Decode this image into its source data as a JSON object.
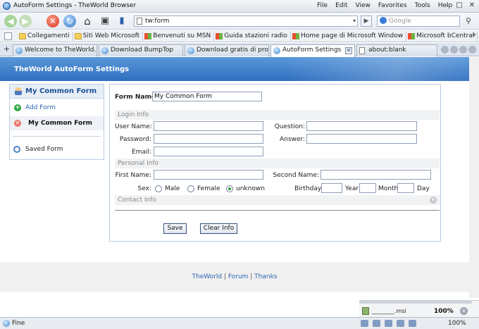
{
  "window": {
    "title": "AutoForm Settings - TheWorld Browser",
    "menu": [
      "File",
      "Edit",
      "View",
      "Favorites",
      "Tools",
      "Help"
    ]
  },
  "nav": {
    "address": "tw:form",
    "search_placeholder": "Google"
  },
  "favorites": [
    {
      "label": "Collegamenti",
      "icon": "folder-icon"
    },
    {
      "label": "Siti Web Microsoft",
      "icon": "folder-icon"
    },
    {
      "label": "Benvenuti su MSN",
      "icon": "windows-icon"
    },
    {
      "label": "Guida stazioni radio",
      "icon": "windows-icon"
    },
    {
      "label": "Home page di Microsoft Window",
      "icon": "windows-icon"
    },
    {
      "label": "Microsoft bCentral",
      "icon": "windows-icon"
    }
  ],
  "tabs": [
    {
      "label": "Welcome to TheWorld..."
    },
    {
      "label": "Download BumpTop"
    },
    {
      "label": "Download gratis di pro..."
    },
    {
      "label": "AutoForm Settings",
      "active": true
    },
    {
      "label": "about:blank"
    }
  ],
  "page": {
    "banner_title": "TheWorld AutoForm Settings",
    "sidebar": {
      "header": "My Common Form",
      "add_form": "Add Form",
      "current_form": "My Common Form",
      "saved_form": "Saved Form"
    },
    "form": {
      "form_name_label": "Form Name:",
      "form_name_value": "My Common Form",
      "login_section": "Login Info",
      "user_name_label": "User Name:",
      "password_label": "Password:",
      "email_label": "Email:",
      "question_label": "Question:",
      "answer_label": "Answer:",
      "personal_section": "Personal Info",
      "first_name_label": "First Name:",
      "second_name_label": "Second Name:",
      "sex_label": "Sex:",
      "sex_options": [
        "Male",
        "Female",
        "unknown"
      ],
      "sex_selected": "unknown",
      "birthday_label": "Birthday:",
      "year_label": "Year",
      "month_label": "Month",
      "day_label": "Day",
      "contact_section": "Contact Info",
      "save_button": "Save",
      "clear_button": "Clear Info"
    },
    "footer": {
      "link1": "TheWorld",
      "link2": "Forum",
      "link3": "Thanks",
      "sep": "|"
    }
  },
  "download": {
    "filename": "________.msi",
    "zoom": "100%"
  },
  "status": {
    "text": "Fine",
    "zoom": "100%"
  }
}
